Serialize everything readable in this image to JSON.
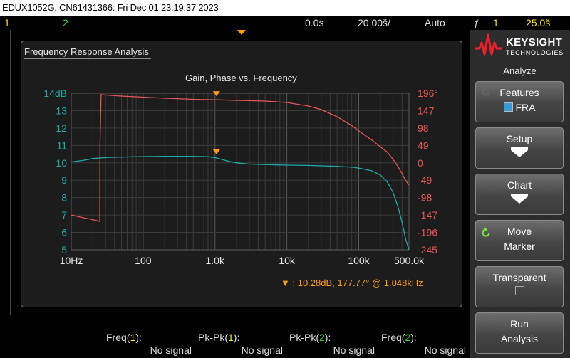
{
  "titlebar": {
    "text": "EDUX1052G, CN61431366: Fri Dec 01 23:19:37 2023"
  },
  "status": {
    "ch1": "1",
    "ch2": "2",
    "delay": "0.0s",
    "timebase": "20.00š/",
    "mode": "Auto",
    "trigger_icon": "ƒ",
    "trigger_channel": "1",
    "trigger_level": "25.0š"
  },
  "panel": {
    "title": "Frequency Response Analysis",
    "chart_title": "Gain, Phase vs. Frequency",
    "marker_symbol": "▼",
    "marker_readout": ":  10.28dB, 177.77° @ 1.048kHz"
  },
  "chart_data": {
    "type": "line",
    "title": "Gain, Phase vs. Frequency",
    "xscale": "log",
    "xlim": [
      10,
      500000
    ],
    "x_tick_labels": [
      "10Hz",
      "100",
      "1.0k",
      "10k",
      "100k",
      "500.0k"
    ],
    "gain_axis": {
      "side": "left",
      "ylim": [
        5,
        14
      ],
      "tick_labels": [
        "14dB",
        "13",
        "12",
        "11",
        "10",
        "9",
        "8",
        "7",
        "6",
        "5"
      ],
      "color": "#1fa8a8"
    },
    "phase_axis": {
      "side": "right",
      "ylim": [
        -245,
        196
      ],
      "tick_labels": [
        "196°",
        "147",
        "98",
        "49",
        "0",
        "-49",
        "-98",
        "-147",
        "-196",
        "-245"
      ],
      "color": "#e85555"
    },
    "series": [
      {
        "axis": "gain",
        "color": "#1fa8a8",
        "x": [
          10,
          15,
          20,
          30,
          50,
          100,
          200,
          500,
          800,
          1048,
          1500,
          2000,
          3000,
          5000,
          10000,
          20000,
          50000,
          80000,
          100000,
          150000,
          200000,
          250000,
          300000,
          350000,
          400000,
          450000,
          500000
        ],
        "y": [
          10.05,
          10.15,
          10.25,
          10.3,
          10.33,
          10.36,
          10.37,
          10.37,
          10.35,
          10.28,
          10.1,
          10.0,
          9.93,
          9.9,
          9.87,
          9.85,
          9.8,
          9.75,
          9.7,
          9.55,
          9.3,
          8.9,
          8.3,
          7.5,
          6.6,
          5.6,
          4.9
        ]
      },
      {
        "axis": "phase",
        "color": "#e85555",
        "x": [
          10,
          15,
          20,
          25,
          25.1,
          26,
          30,
          50,
          100,
          200,
          500,
          1048,
          2000,
          5000,
          10000,
          20000,
          30000,
          50000,
          80000,
          100000,
          150000,
          200000,
          250000,
          300000,
          350000,
          400000,
          450000,
          500000
        ],
        "y": [
          -147,
          -155,
          -160,
          -165,
          50,
          192,
          191,
          188,
          185,
          182,
          179,
          177.77,
          176,
          174,
          170,
          160,
          150,
          130,
          105,
          90,
          65,
          45,
          30,
          10,
          -10,
          -30,
          -50,
          -62
        ]
      }
    ],
    "markers": [
      {
        "axis": "phase",
        "x": 1048,
        "y": 177.77
      },
      {
        "axis": "gain",
        "x": 1048,
        "y": 10.28
      }
    ],
    "grid": true
  },
  "sidebar": {
    "logo_line1": "KEYSIGHT",
    "logo_line2": "TECHNOLOGIES",
    "heading": "Analyze",
    "buttons": [
      {
        "line1": "Features",
        "line2": "FRA"
      },
      {
        "line1": "Setup"
      },
      {
        "line1": "Chart"
      },
      {
        "line1": "Move",
        "line2": "Marker"
      },
      {
        "line1": "Transparent"
      },
      {
        "line1": "Run",
        "line2": "Analysis"
      }
    ]
  },
  "measurements": [
    {
      "name": "Freq(",
      "ch": "1",
      "suffix": "):",
      "value": "No signal"
    },
    {
      "name": "Pk-Pk(",
      "ch": "1",
      "suffix": "):",
      "value": "No signal"
    },
    {
      "name": "Pk-Pk(",
      "ch": "2",
      "suffix": "):",
      "value": "No signal"
    },
    {
      "name": "Freq(",
      "ch": "2",
      "suffix": "):",
      "value": "No signal"
    }
  ],
  "colors": {
    "ch1": "#ffe400",
    "ch2": "#3fd03f",
    "accent": "#ff9a1a",
    "gain": "#1fa8a8",
    "phase": "#e85555"
  }
}
